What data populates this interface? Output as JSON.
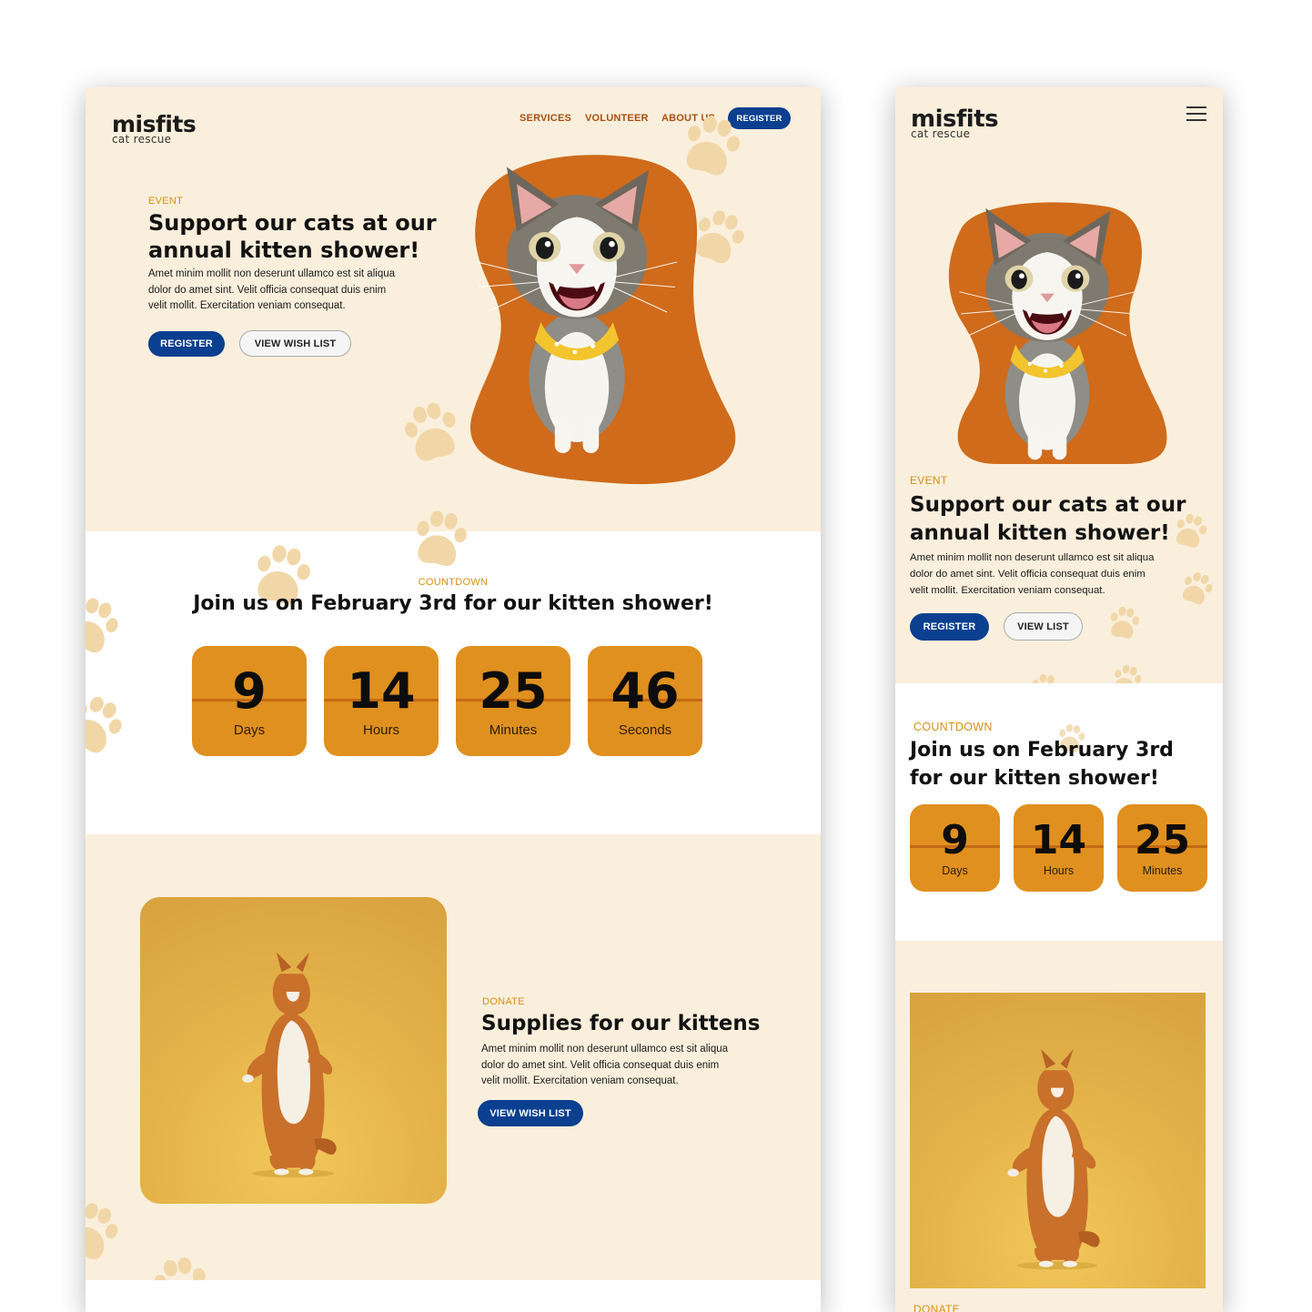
{
  "brand": {
    "name": "misfits",
    "tagline": "cat rescue"
  },
  "nav": {
    "services": "SERVICES",
    "volunteer": "VOLUNTEER",
    "about": "ABOUT US",
    "register": "REGISTER"
  },
  "hero": {
    "eyebrow": "EVENT",
    "title_line1": "Support our cats at our",
    "title_line2": "annual kitten shower!",
    "body_line1": "Amet minim mollit non deserunt ullamco est sit aliqua",
    "body_line2": "dolor do amet sint. Velit officia consequat duis enim",
    "body_line3": "velit mollit. Exercitation veniam consequat.",
    "register": "REGISTER",
    "wish_list": "VIEW WISH LIST",
    "mobile_list": "VIEW LIST"
  },
  "countdown": {
    "eyebrow": "COUNTDOWN",
    "title": "Join us on February 3rd for our kitten shower!",
    "title_line1": "Join us on February 3rd",
    "title_line2": "for our kitten shower!",
    "days": {
      "value": "9",
      "label": "Days"
    },
    "hours": {
      "value": "14",
      "label": "Hours"
    },
    "minutes": {
      "value": "25",
      "label": "Minutes"
    },
    "seconds": {
      "value": "46",
      "label": "Seconds"
    }
  },
  "donate": {
    "eyebrow": "DONATE",
    "title": "Supplies for our kittens",
    "body_line1": "Amet minim mollit non deserunt ullamco est sit aliqua",
    "body_line2": "dolor do amet sint. Velit officia consequat duis enim",
    "body_line3": "velit mollit. Exercitation veniam consequat.",
    "button": "VIEW WISH LIST"
  },
  "colors": {
    "cream": "#faefdc",
    "orange_blob": "#cf6b1b",
    "tile": "#e0901f",
    "navy": "#0b3f8f",
    "eyebrow": "#d98e18",
    "paw": "#f1d7a8"
  },
  "icons": [
    "paw-print-icon",
    "hamburger-menu-icon"
  ]
}
